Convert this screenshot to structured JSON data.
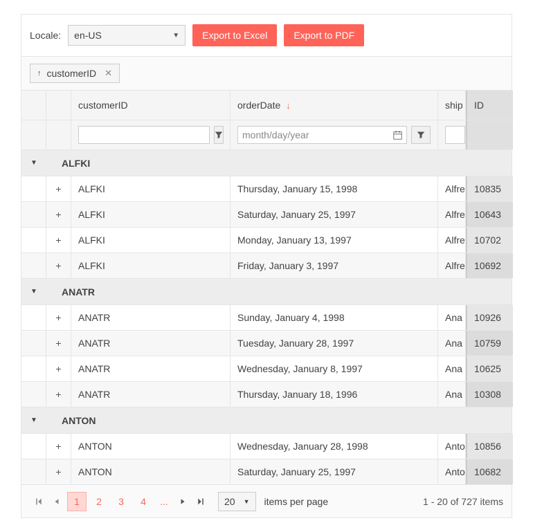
{
  "toolbar": {
    "locale_label": "Locale:",
    "locale_value": "en-US",
    "export_excel": "Export to Excel",
    "export_pdf": "Export to PDF"
  },
  "grouping": {
    "chip_label": "customerID"
  },
  "columns": {
    "customerID": "customerID",
    "orderDate": "orderDate",
    "ship": "ship",
    "id": "ID"
  },
  "filters": {
    "date_placeholder": "month/day/year"
  },
  "groups": [
    {
      "name": "ALFKI",
      "rows": [
        {
          "customerID": "ALFKI",
          "orderDate": "Thursday, January 15, 1998",
          "ship": "Alfre",
          "id": "10835"
        },
        {
          "customerID": "ALFKI",
          "orderDate": "Saturday, January 25, 1997",
          "ship": "Alfre",
          "id": "10643"
        },
        {
          "customerID": "ALFKI",
          "orderDate": "Monday, January 13, 1997",
          "ship": "Alfre",
          "id": "10702"
        },
        {
          "customerID": "ALFKI",
          "orderDate": "Friday, January 3, 1997",
          "ship": "Alfre",
          "id": "10692"
        }
      ]
    },
    {
      "name": "ANATR",
      "rows": [
        {
          "customerID": "ANATR",
          "orderDate": "Sunday, January 4, 1998",
          "ship": "Ana",
          "id": "10926"
        },
        {
          "customerID": "ANATR",
          "orderDate": "Tuesday, January 28, 1997",
          "ship": "Ana",
          "id": "10759"
        },
        {
          "customerID": "ANATR",
          "orderDate": "Wednesday, January 8, 1997",
          "ship": "Ana",
          "id": "10625"
        },
        {
          "customerID": "ANATR",
          "orderDate": "Thursday, January 18, 1996",
          "ship": "Ana",
          "id": "10308"
        }
      ]
    },
    {
      "name": "ANTON",
      "rows": [
        {
          "customerID": "ANTON",
          "orderDate": "Wednesday, January 28, 1998",
          "ship": "Anto",
          "id": "10856"
        },
        {
          "customerID": "ANTON",
          "orderDate": "Saturday, January 25, 1997",
          "ship": "Anto",
          "id": "10682"
        }
      ]
    }
  ],
  "pager": {
    "pages": [
      "1",
      "2",
      "3",
      "4"
    ],
    "ellipsis": "...",
    "page_size": "20",
    "items_per_page": "items per page",
    "info": "1 - 20 of 727 items"
  }
}
